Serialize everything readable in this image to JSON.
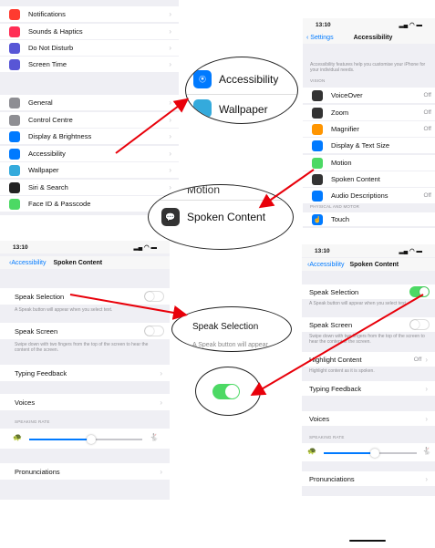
{
  "panel1": {
    "items": [
      {
        "label": "Notifications",
        "color": "#ff3b30",
        "icon": "notifications-icon"
      },
      {
        "label": "Sounds & Haptics",
        "color": "#ff2d55",
        "icon": "sound-icon"
      },
      {
        "label": "Do Not Disturb",
        "color": "#5856d6",
        "icon": "moon-icon"
      },
      {
        "label": "Screen Time",
        "color": "#5856d6",
        "icon": "hourglass-icon"
      },
      {
        "label": "General",
        "color": "#8e8e93",
        "icon": "gear-icon"
      },
      {
        "label": "Control Centre",
        "color": "#8e8e93",
        "icon": "control-centre-icon"
      },
      {
        "label": "Display & Brightness",
        "color": "#007aff",
        "icon": "display-icon"
      },
      {
        "label": "Accessibility",
        "color": "#007aff",
        "icon": "accessibility-icon"
      },
      {
        "label": "Wallpaper",
        "color": "#34aadc",
        "icon": "wallpaper-icon"
      },
      {
        "label": "Siri & Search",
        "color": "#222222",
        "icon": "siri-icon"
      },
      {
        "label": "Face ID & Passcode",
        "color": "#4cd964",
        "icon": "faceid-icon"
      }
    ]
  },
  "bubble1": {
    "label": "Accessibility",
    "next": "Wallpaper"
  },
  "panel2": {
    "time": "13:10",
    "back": "Settings",
    "title": "Accessibility",
    "desc": "Accessibility features help you customise your iPhone for your individual needs.",
    "vision_header": "VISION",
    "items": [
      {
        "label": "VoiceOver",
        "value": "Off",
        "color": "#333333"
      },
      {
        "label": "Zoom",
        "value": "Off",
        "color": "#333333"
      },
      {
        "label": "Magnifier",
        "value": "Off",
        "color": "#ff9500"
      },
      {
        "label": "Display & Text Size",
        "value": "",
        "color": "#007aff"
      },
      {
        "label": "Motion",
        "value": "",
        "color": "#4cd964"
      },
      {
        "label": "Spoken Content",
        "value": "",
        "color": "#333333"
      },
      {
        "label": "Audio Descriptions",
        "value": "Off",
        "color": "#007aff"
      }
    ],
    "motor_header": "PHYSICAL AND MOTOR",
    "touch": "Touch"
  },
  "bubble2": {
    "label": "Spoken Content",
    "prev": "Motion"
  },
  "panel3": {
    "time": "13:10",
    "back": "Accessibility",
    "title": "Spoken Content",
    "speak_selection": "Speak Selection",
    "speak_selection_note": "A Speak button will appear when you select text.",
    "speak_screen": "Speak Screen",
    "speak_screen_note": "Swipe down with two fingers from the top of the screen to hear the content of the screen.",
    "typing_feedback": "Typing Feedback",
    "voices": "Voices",
    "speaking_rate": "SPEAKING RATE",
    "speaking_rate_value": 0.55,
    "pronunciations": "Pronunciations"
  },
  "bubble3": {
    "label": "Speak Selection",
    "note": "A Speak button will appear"
  },
  "panel4": {
    "time": "13:10",
    "back": "Accessibility",
    "title": "Spoken Content",
    "speak_selection": "Speak Selection",
    "speak_selection_note": "A Speak button will appear when you select text.",
    "speak_screen": "Speak Screen",
    "speak_screen_note": "Swipe down with two fingers from the top of the screen to hear the content of the screen.",
    "highlight_content": "Highlight Content",
    "highlight_value": "Off",
    "highlight_note": "Highlight content as it is spoken.",
    "typing_feedback": "Typing Feedback",
    "voices": "Voices",
    "speaking_rate": "SPEAKING RATE",
    "speaking_rate_value": 0.55,
    "pronunciations": "Pronunciations"
  },
  "colors": {
    "arrow": "#e8000a",
    "ios_blue": "#007aff",
    "toggle_on": "#4cd964"
  }
}
